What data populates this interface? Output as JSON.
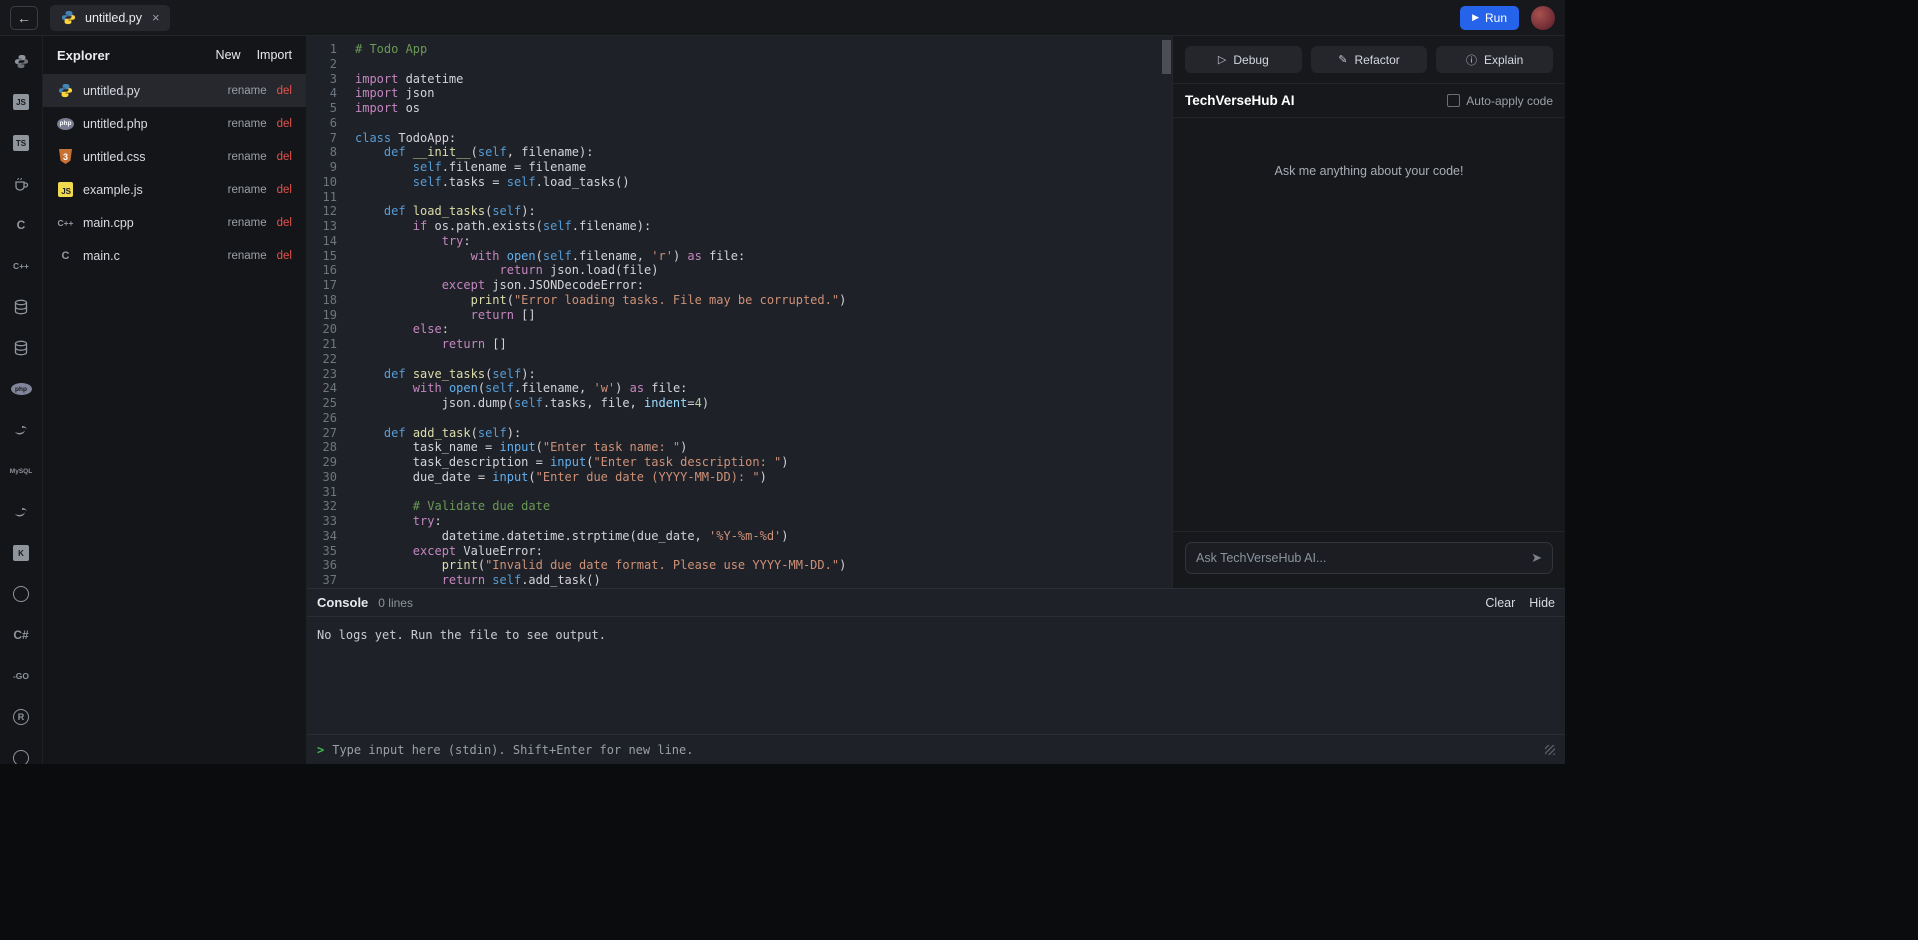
{
  "topbar": {
    "back_icon": "←",
    "tab": {
      "title": "untitled.py",
      "close_icon": "×"
    },
    "run": {
      "icon": "▶",
      "label": "Run"
    }
  },
  "rail": {
    "items": [
      {
        "name": "python",
        "kind": "python-gray"
      },
      {
        "name": "javascript",
        "kind": "tile",
        "text": "JS"
      },
      {
        "name": "typescript",
        "kind": "tile",
        "text": "TS"
      },
      {
        "name": "java",
        "kind": "cup"
      },
      {
        "name": "c",
        "kind": "text",
        "text": "C"
      },
      {
        "name": "cpp",
        "kind": "text-small",
        "text": "C++"
      },
      {
        "name": "database",
        "kind": "db"
      },
      {
        "name": "database-alt",
        "kind": "db"
      },
      {
        "name": "php",
        "kind": "oval",
        "text": "php"
      },
      {
        "name": "mysql-dolphin",
        "kind": "swoosh"
      },
      {
        "name": "mysql",
        "kind": "text-tiny",
        "text": "MySQL"
      },
      {
        "name": "swift",
        "kind": "swoosh"
      },
      {
        "name": "kotlin",
        "kind": "tile",
        "text": "K"
      },
      {
        "name": "mongodb",
        "kind": "circle",
        "text": ""
      },
      {
        "name": "csharp",
        "kind": "text",
        "text": "C#"
      },
      {
        "name": "go",
        "kind": "text-small",
        "text": "-GO"
      },
      {
        "name": "r",
        "kind": "circle",
        "text": "R"
      },
      {
        "name": "ruby",
        "kind": "circle",
        "text": ""
      }
    ]
  },
  "explorer": {
    "title": "Explorer",
    "new_label": "New",
    "import_label": "Import",
    "rename_label": "rename",
    "delete_label": "del",
    "files": [
      {
        "name": "untitled.py",
        "icon": "py",
        "selected": true
      },
      {
        "name": "untitled.php",
        "icon": "php",
        "selected": false
      },
      {
        "name": "untitled.css",
        "icon": "css",
        "selected": false
      },
      {
        "name": "example.js",
        "icon": "js",
        "selected": false
      },
      {
        "name": "main.cpp",
        "icon": "cpp",
        "selected": false
      },
      {
        "name": "main.c",
        "icon": "c",
        "selected": false
      }
    ]
  },
  "editor": {
    "language": "python",
    "lines": [
      [
        [
          "cm",
          "# Todo App"
        ]
      ],
      [],
      [
        [
          "kw",
          "import"
        ],
        [
          "pl",
          " datetime"
        ]
      ],
      [
        [
          "kw",
          "import"
        ],
        [
          "pl",
          " json"
        ]
      ],
      [
        [
          "kw",
          "import"
        ],
        [
          "pl",
          " os"
        ]
      ],
      [],
      [
        [
          "kd",
          "class"
        ],
        [
          "pl",
          " TodoApp:"
        ]
      ],
      [
        [
          "pl",
          "    "
        ],
        [
          "kd",
          "def"
        ],
        [
          "pl",
          " "
        ],
        [
          "fn",
          "__init__"
        ],
        [
          "pl",
          "("
        ],
        [
          "kd",
          "self"
        ],
        [
          "pl",
          ", filename):"
        ]
      ],
      [
        [
          "pl",
          "        "
        ],
        [
          "kd",
          "self"
        ],
        [
          "pl",
          ".filename = filename"
        ]
      ],
      [
        [
          "pl",
          "        "
        ],
        [
          "kd",
          "self"
        ],
        [
          "pl",
          ".tasks = "
        ],
        [
          "kd",
          "self"
        ],
        [
          "pl",
          ".load_tasks()"
        ]
      ],
      [],
      [
        [
          "pl",
          "    "
        ],
        [
          "kd",
          "def"
        ],
        [
          "pl",
          " "
        ],
        [
          "fn",
          "load_tasks"
        ],
        [
          "pl",
          "("
        ],
        [
          "kd",
          "self"
        ],
        [
          "pl",
          "):"
        ]
      ],
      [
        [
          "pl",
          "        "
        ],
        [
          "kw",
          "if"
        ],
        [
          "pl",
          " os.path.exists("
        ],
        [
          "kd",
          "self"
        ],
        [
          "pl",
          ".filename):"
        ]
      ],
      [
        [
          "pl",
          "            "
        ],
        [
          "kw",
          "try"
        ],
        [
          "pl",
          ":"
        ]
      ],
      [
        [
          "pl",
          "                "
        ],
        [
          "kw",
          "with"
        ],
        [
          "pl",
          " "
        ],
        [
          "bi",
          "open"
        ],
        [
          "pl",
          "("
        ],
        [
          "kd",
          "self"
        ],
        [
          "pl",
          ".filename, "
        ],
        [
          "st",
          "'r'"
        ],
        [
          "pl",
          ") "
        ],
        [
          "kw",
          "as"
        ],
        [
          "pl",
          " file:"
        ]
      ],
      [
        [
          "pl",
          "                    "
        ],
        [
          "kw",
          "return"
        ],
        [
          "pl",
          " json.load(file)"
        ]
      ],
      [
        [
          "pl",
          "            "
        ],
        [
          "kw",
          "except"
        ],
        [
          "pl",
          " json.JSONDecodeError:"
        ]
      ],
      [
        [
          "pl",
          "                "
        ],
        [
          "fn",
          "print"
        ],
        [
          "pl",
          "("
        ],
        [
          "st",
          "\"Error loading tasks. File may be corrupted.\""
        ],
        [
          "pl",
          ")"
        ]
      ],
      [
        [
          "pl",
          "                "
        ],
        [
          "kw",
          "return"
        ],
        [
          "pl",
          " []"
        ]
      ],
      [
        [
          "pl",
          "        "
        ],
        [
          "kw",
          "else"
        ],
        [
          "pl",
          ":"
        ]
      ],
      [
        [
          "pl",
          "            "
        ],
        [
          "kw",
          "return"
        ],
        [
          "pl",
          " []"
        ]
      ],
      [],
      [
        [
          "pl",
          "    "
        ],
        [
          "kd",
          "def"
        ],
        [
          "pl",
          " "
        ],
        [
          "fn",
          "save_tasks"
        ],
        [
          "pl",
          "("
        ],
        [
          "kd",
          "self"
        ],
        [
          "pl",
          "):"
        ]
      ],
      [
        [
          "pl",
          "        "
        ],
        [
          "kw",
          "with"
        ],
        [
          "pl",
          " "
        ],
        [
          "bi",
          "open"
        ],
        [
          "pl",
          "("
        ],
        [
          "kd",
          "self"
        ],
        [
          "pl",
          ".filename, "
        ],
        [
          "st",
          "'w'"
        ],
        [
          "pl",
          ") "
        ],
        [
          "kw",
          "as"
        ],
        [
          "pl",
          " file:"
        ]
      ],
      [
        [
          "pl",
          "            json.dump("
        ],
        [
          "kd",
          "self"
        ],
        [
          "pl",
          ".tasks, file, "
        ],
        [
          "ar",
          "indent"
        ],
        [
          "pl",
          "="
        ],
        [
          "nu",
          "4"
        ],
        [
          "pl",
          ")"
        ]
      ],
      [],
      [
        [
          "pl",
          "    "
        ],
        [
          "kd",
          "def"
        ],
        [
          "pl",
          " "
        ],
        [
          "fn",
          "add_task"
        ],
        [
          "pl",
          "("
        ],
        [
          "kd",
          "self"
        ],
        [
          "pl",
          "):"
        ]
      ],
      [
        [
          "pl",
          "        task_name = "
        ],
        [
          "bi",
          "input"
        ],
        [
          "pl",
          "("
        ],
        [
          "st",
          "\"Enter task name: \""
        ],
        [
          "pl",
          ")"
        ]
      ],
      [
        [
          "pl",
          "        task_description = "
        ],
        [
          "bi",
          "input"
        ],
        [
          "pl",
          "("
        ],
        [
          "st",
          "\"Enter task description: \""
        ],
        [
          "pl",
          ")"
        ]
      ],
      [
        [
          "pl",
          "        due_date = "
        ],
        [
          "bi",
          "input"
        ],
        [
          "pl",
          "("
        ],
        [
          "st",
          "\"Enter due date (YYYY-MM-DD): \""
        ],
        [
          "pl",
          ")"
        ]
      ],
      [],
      [
        [
          "pl",
          "        "
        ],
        [
          "cm",
          "# Validate due date"
        ]
      ],
      [
        [
          "pl",
          "        "
        ],
        [
          "kw",
          "try"
        ],
        [
          "pl",
          ":"
        ]
      ],
      [
        [
          "pl",
          "            datetime.datetime.strptime(due_date, "
        ],
        [
          "st",
          "'%Y-%m-%d'"
        ],
        [
          "pl",
          ")"
        ]
      ],
      [
        [
          "pl",
          "        "
        ],
        [
          "kw",
          "except"
        ],
        [
          "pl",
          " ValueError:"
        ]
      ],
      [
        [
          "pl",
          "            "
        ],
        [
          "fn",
          "print"
        ],
        [
          "pl",
          "("
        ],
        [
          "st",
          "\"Invalid due date format. Please use YYYY-MM-DD.\""
        ],
        [
          "pl",
          ")"
        ]
      ],
      [
        [
          "pl",
          "            "
        ],
        [
          "kw",
          "return"
        ],
        [
          "pl",
          " "
        ],
        [
          "kd",
          "self"
        ],
        [
          "pl",
          ".add_task()"
        ]
      ]
    ]
  },
  "assistant": {
    "actions": [
      {
        "name": "debug",
        "icon": "▷",
        "label": "Debug"
      },
      {
        "name": "refactor",
        "icon": "✎",
        "label": "Refactor"
      },
      {
        "name": "explain",
        "icon": "ⓘ",
        "label": "Explain"
      }
    ],
    "title": "TechVerseHub AI",
    "auto_apply_label": "Auto-apply code",
    "empty_message": "Ask me anything about your code!",
    "input_placeholder": "Ask TechVerseHub AI...",
    "send_icon": "➤"
  },
  "console": {
    "title": "Console",
    "count_label": "0 lines",
    "clear_label": "Clear",
    "hide_label": "Hide",
    "empty_message": "No logs yet. Run the file to see output.",
    "prompt_icon": ">",
    "input_placeholder": "Type input here (stdin). Shift+Enter for new line."
  },
  "colors": {
    "accent_blue": "#2563eb",
    "delete_red": "#e5534b",
    "prompt_green": "#3fb950",
    "python_blue": "#4584b6",
    "python_yellow": "#ffd43b",
    "js_yellow": "#f0db4f"
  }
}
